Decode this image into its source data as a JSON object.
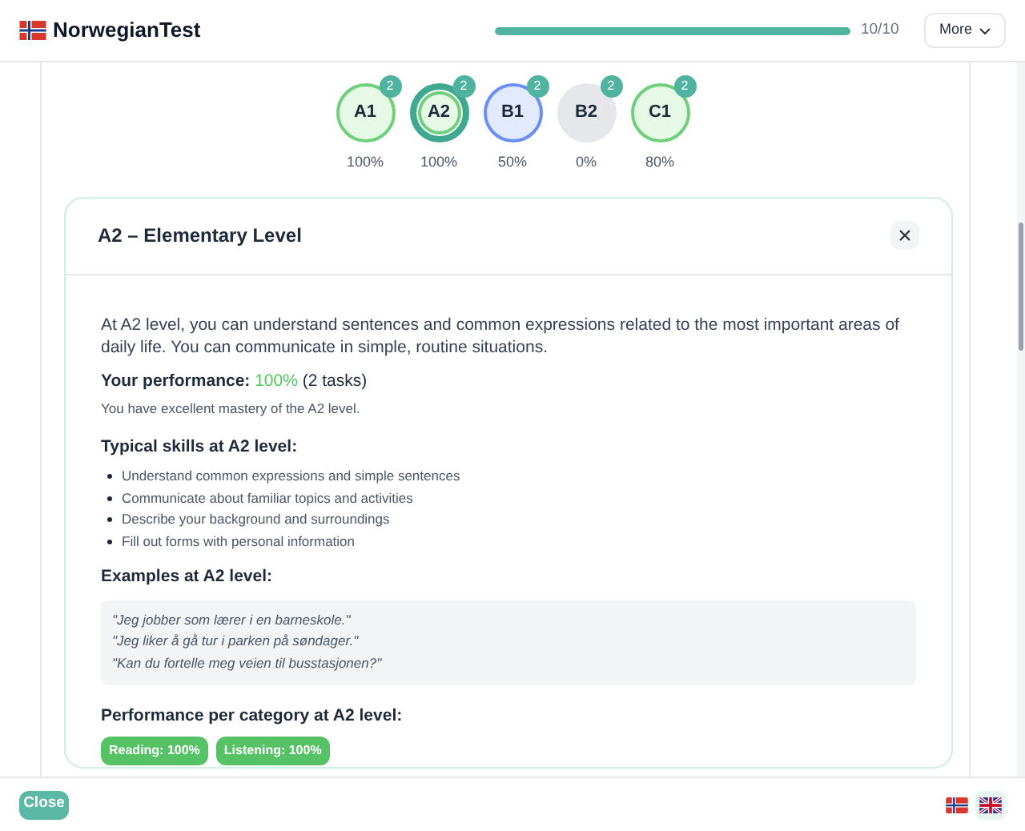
{
  "header": {
    "brand": "NorwegianTest",
    "progress": {
      "level": 1.0,
      "reading": "10/10"
    },
    "more_button": "More"
  },
  "levels": [
    {
      "code": "A1",
      "count": "2",
      "percent": "100%",
      "kind": "passed",
      "selected": false
    },
    {
      "code": "A2",
      "count": "2",
      "percent": "100%",
      "kind": "passed",
      "selected": true
    },
    {
      "code": "B1",
      "count": "2",
      "percent": "50%",
      "kind": "partial",
      "selected": false
    },
    {
      "code": "B2",
      "count": "2",
      "percent": "0%",
      "kind": "empty",
      "selected": false
    },
    {
      "code": "C1",
      "count": "2",
      "percent": "80%",
      "kind": "passed",
      "selected": false
    }
  ],
  "detail": {
    "title": "A2 – Elementary Level",
    "description": "At A2 level, you can understand sentences and common expressions related to the most important areas of daily life. You can communicate in simple, routine situations.",
    "performance_label": "Your performance:",
    "performance_value": "100%",
    "performance_tasks": "(2 tasks)",
    "performance_note": "You have excellent mastery of the A2 level.",
    "skills_heading": "Typical skills at A2 level:",
    "skills": [
      "Understand common expressions and simple sentences",
      "Communicate about familiar topics and activities",
      "Describe your background and surroundings",
      "Fill out forms with personal information"
    ],
    "examples_heading": "Examples at A2 level:",
    "examples": [
      "\"Jeg jobber som lærer i en barneskole.\"",
      "\"Jeg liker å gå tur i parken på søndager.\"",
      "\"Kan du fortelle meg veien til busstasjonen?\""
    ],
    "categories_heading": "Performance per category at A2 level:",
    "categories": [
      "Reading: 100%",
      "Listening: 100%"
    ]
  },
  "footer": {
    "close_button": "Close",
    "languages": [
      {
        "kind": "norwegian",
        "selected": false
      },
      {
        "kind": "english",
        "selected": true
      }
    ]
  }
}
